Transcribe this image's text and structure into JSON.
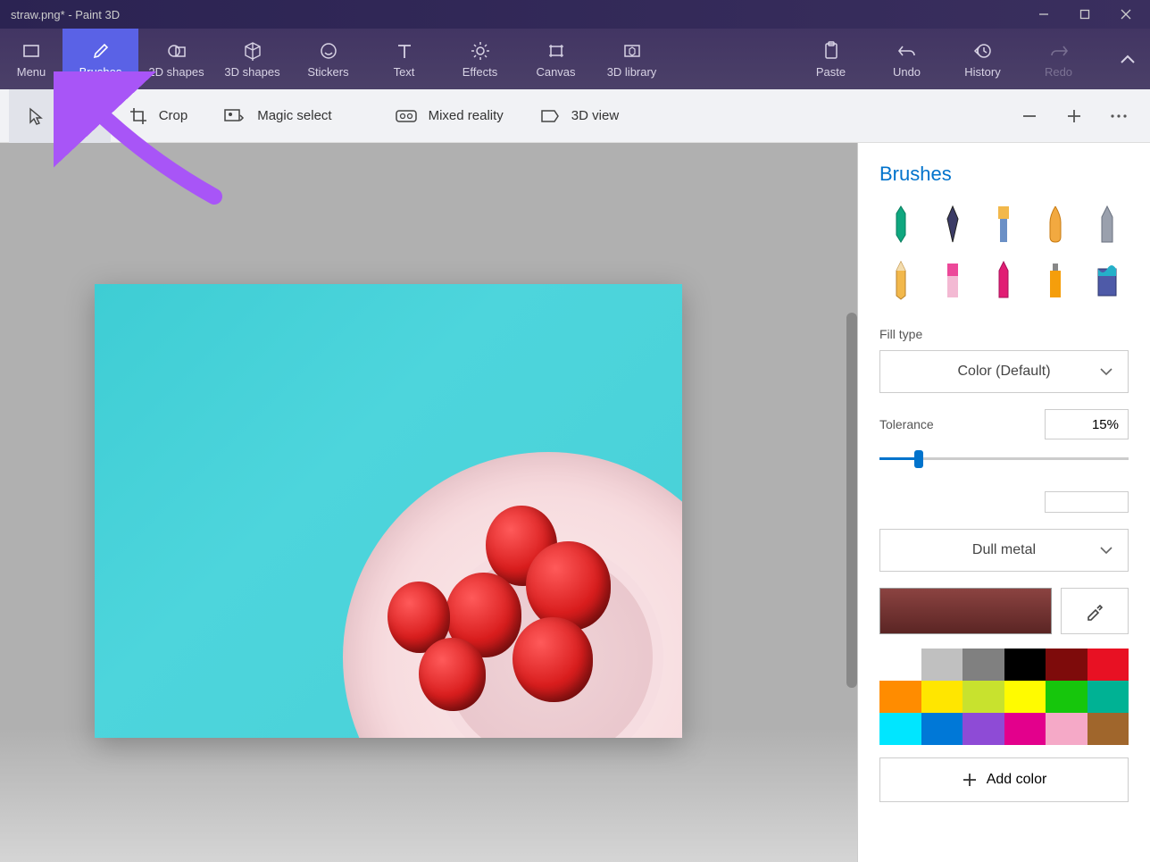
{
  "title": "straw.png* - Paint 3D",
  "toolbar": {
    "menu": "Menu",
    "brushes": "Brushes",
    "shapes2d": "2D shapes",
    "shapes3d": "3D shapes",
    "stickers": "Stickers",
    "text": "Text",
    "effects": "Effects",
    "canvas": "Canvas",
    "library3d": "3D library",
    "paste": "Paste",
    "undo": "Undo",
    "history": "History",
    "redo": "Redo"
  },
  "subbar": {
    "select": "Select",
    "crop": "Crop",
    "magic_select": "Magic select",
    "mixed_reality": "Mixed reality",
    "view3d": "3D view"
  },
  "sidebar": {
    "heading": "Brushes",
    "fill_type_label": "Fill type",
    "fill_type_value": "Color (Default)",
    "tolerance_label": "Tolerance",
    "tolerance_value": "15%",
    "material_value": "Dull metal",
    "add_color": "Add color"
  },
  "palette": [
    "#ffffff",
    "#c0c0c0",
    "#808080",
    "#000000",
    "#7e0b0b",
    "#e81123",
    "#ff8c00",
    "#ffe600",
    "#c8e22e",
    "#fffb00",
    "#16c60c",
    "#00b294",
    "#00e6ff",
    "#0078d7",
    "#8e4bd6",
    "#e3008c",
    "#f5a9c7",
    "#a0662c"
  ]
}
